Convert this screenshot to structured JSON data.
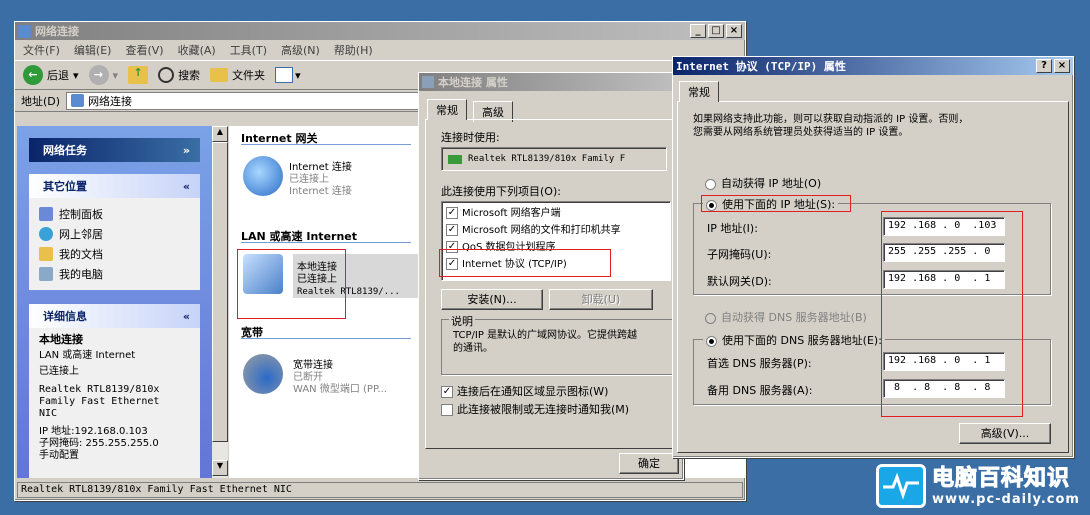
{
  "explorer": {
    "title": "网络连接",
    "menu": [
      "文件(F)",
      "编辑(E)",
      "查看(V)",
      "收藏(A)",
      "工具(T)",
      "高级(N)",
      "帮助(H)"
    ],
    "toolbar": {
      "back": "后退",
      "search": "搜索",
      "folders": "文件夹"
    },
    "address_label": "地址(D)",
    "address_value": "网络连接",
    "panels": {
      "network_tasks": "网络任务",
      "other_places": "其它位置",
      "other_items": [
        "控制面板",
        "网上邻居",
        "我的文档",
        "我的电脑"
      ],
      "details": "详细信息",
      "details_lines": [
        "本地连接",
        "LAN 或高速 Internet",
        "已连接上",
        "Realtek RTL8139/810x",
        "Family Fast Ethernet",
        "NIC",
        "IP 地址:192.168.0.103",
        "子网掩码: 255.255.255.0",
        "手动配置"
      ]
    },
    "groups": {
      "internet_gateway": "Internet 网关",
      "lan": "LAN 或高速 Internet",
      "broadband": "宽带"
    },
    "items": {
      "gateway": {
        "name": "Internet 连接",
        "status": "已连接上",
        "type": "Internet 连接"
      },
      "local": {
        "name": "本地连接",
        "status": "已连接上",
        "type": "Realtek RTL8139/..."
      },
      "broadband": {
        "name": "宽带连接",
        "status": "已断开",
        "type": "WAN 微型端口 (PP..."
      }
    },
    "statusbar": "Realtek RTL8139/810x Family Fast Ethernet NIC"
  },
  "props": {
    "title": "本地连接 属性",
    "tabs": [
      "常规",
      "高级"
    ],
    "connect_using_label": "连接时使用:",
    "adapter": "Realtek RTL8139/810x Family F",
    "items_label": "此连接使用下列项目(O):",
    "items": [
      "Microsoft 网络客户端",
      "Microsoft 网络的文件和打印机共享",
      "QoS 数据包计划程序",
      "Internet 协议 (TCP/IP)"
    ],
    "install_btn": "安装(N)...",
    "uninstall_btn": "卸载(U)",
    "desc_label": "说明",
    "desc_text_1": "TCP/IP 是默认的广域网协议。它提供跨越",
    "desc_text_2": "的通讯。",
    "chk_notify": "连接后在通知区域显示图标(W)",
    "chk_limited": "此连接被限制或无连接时通知我(M)",
    "ok_btn": "确定"
  },
  "tcpip": {
    "title": "Internet 协议 (TCP/IP) 属性",
    "tab": "常规",
    "intro_1": "如果网络支持此功能，则可以获取自动指派的 IP 设置。否则，",
    "intro_2": "您需要从网络系统管理员处获得适当的 IP 设置。",
    "auto_ip": "自动获得 IP 地址(O)",
    "manual_ip": "使用下面的 IP 地址(S):",
    "ip_label": "IP 地址(I):",
    "ip_value": "192 .168 . 0  .103",
    "mask_label": "子网掩码(U):",
    "mask_value": "255 .255 .255 . 0",
    "gateway_label": "默认网关(D):",
    "gateway_value": "192 .168 . 0  . 1",
    "auto_dns": "自动获得 DNS 服务器地址(B)",
    "manual_dns": "使用下面的 DNS 服务器地址(E):",
    "dns1_label": "首选 DNS 服务器(P):",
    "dns1_value": "192 .168 . 0  . 1",
    "dns2_label": "备用 DNS 服务器(A):",
    "dns2_value": " 8  . 8  . 8  . 8",
    "advanced_btn": "高级(V)..."
  },
  "watermark": {
    "cn": "电脑百科知识",
    "url": "www.pc-daily.com"
  }
}
